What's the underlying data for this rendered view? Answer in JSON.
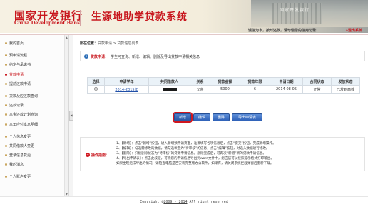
{
  "header": {
    "bank_name_cn": "国家开发银行",
    "bank_name_en": "China Development Bank",
    "system_title": "生源地助学贷款系统",
    "building_sign": "国家开发银行",
    "welcome_text": "诚信为本，按时还款，请珍惜您的信用记录！",
    "logout_label": "▸退出系统"
  },
  "sidebar": {
    "items": [
      {
        "label": "我的首页"
      },
      {
        "label": "预申请流程"
      },
      {
        "label": "约定与承诺书"
      },
      {
        "label": "贷款申请"
      },
      {
        "label": "提前还款申请"
      },
      {
        "label": "贷款及应还款查询"
      },
      {
        "label": "还款记录"
      },
      {
        "label": "本金还款计划查询"
      },
      {
        "label": "本年应付本息明细"
      },
      {
        "label": "个人信息变更"
      },
      {
        "label": "共同借款人变更"
      },
      {
        "label": "登录信息变更"
      },
      {
        "label": "我的消息"
      },
      {
        "label": "个人账户变更"
      }
    ],
    "active_index": 3
  },
  "main": {
    "breadcrumb_prefix": "所在位置：",
    "breadcrumb_path": "贷款申请 > 贷款信息列表",
    "info_label": "贷款申请：",
    "info_text": "学生可查询、新增、编辑、删除及导出贷款申请相关信息",
    "table": {
      "headers": [
        "选择",
        "申请学年",
        "共同借款人",
        "关系",
        "贷款金额",
        "贷款年限",
        "申请日期",
        "合同状态",
        "发放状态"
      ],
      "rows": [
        {
          "year": "2014-2015年",
          "relation": "父亲",
          "amount": "5000",
          "term": "6",
          "date": "2014-08-05",
          "contract_status": "正常",
          "release_status": "已发到高校"
        }
      ]
    },
    "buttons": {
      "add": "新增",
      "edit": "编辑",
      "delete": "删除",
      "export": "导出申请表"
    },
    "guide": {
      "label": "操作指南：",
      "lines": [
        "1、【新增】：点击“新增”按钮，进入新增预申请页面，准确填写各项信息后，点击“提交”按钮，完成新增操作。",
        "2、【编辑】：勾选需修改的数据，请勾选状态为“待审核”的信息，点击“编辑”按钮，对选入数据进行修改。",
        "3、【删除】：只能删除状态为“待审核”的贷款申请信息，删除完成后，可再次“新增”新的贷款申请信息。",
        "4、【导出申请表】：点击此按钮，可将您的申请信息导出到word文件中，您应该可以按照提示格式打印输出。",
        "如果出现无法导出的情况，请检查电脑是否安装完整版办公软件，如果有，请关闭系统拦截弹窗后重新下载。"
      ]
    }
  },
  "footer": {
    "prefix": "Copyright ©",
    "year": "2009 - 2014",
    "suffix": " All right reserved"
  }
}
